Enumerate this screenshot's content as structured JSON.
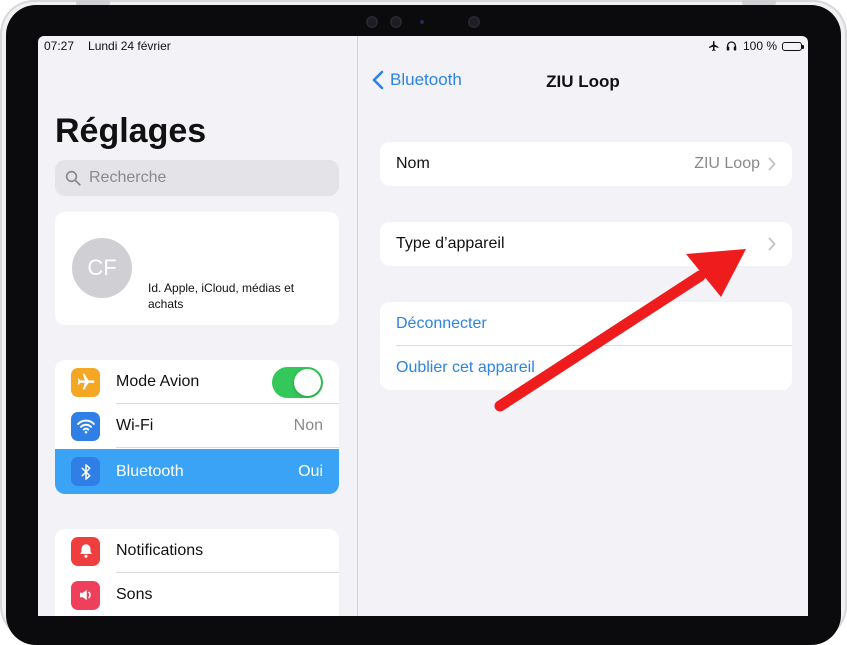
{
  "status_bar": {
    "time": "07:27",
    "date": "Lundi 24 février",
    "battery": "100 %"
  },
  "sidebar": {
    "title": "Réglages",
    "search_placeholder": "Recherche",
    "profile": {
      "initials": "CF",
      "subtitle": "Id. Apple, iCloud, médias et achats"
    },
    "group1": [
      {
        "label": "Mode Avion",
        "icon": "airplane-icon",
        "icon_color": "#f5a623",
        "toggle_on": true
      },
      {
        "label": "Wi-Fi",
        "value": "Non",
        "icon": "wifi-icon",
        "icon_color": "#2f7fe6"
      },
      {
        "label": "Bluetooth",
        "value": "Oui",
        "icon": "bluetooth-icon",
        "icon_color": "#2f7fe6",
        "selected": true
      }
    ],
    "group2": [
      {
        "label": "Notifications",
        "icon": "bell-icon",
        "icon_color": "#ef3e3e"
      },
      {
        "label": "Sons",
        "icon": "speaker-icon",
        "icon_color": "#ee3f5c"
      }
    ]
  },
  "detail": {
    "back_label": "Bluetooth",
    "title": "ZIU Loop",
    "name_row": {
      "label": "Nom",
      "value": "ZIU Loop"
    },
    "type_row": {
      "label": "Type d’appareil"
    },
    "disconnect_label": "Déconnecter",
    "forget_label": "Oublier cet appareil"
  },
  "colors": {
    "accent": "#2d83e6",
    "selection": "#3aa3f5",
    "toggle_on": "#34c759",
    "annotation_arrow": "#ee1c1c"
  }
}
